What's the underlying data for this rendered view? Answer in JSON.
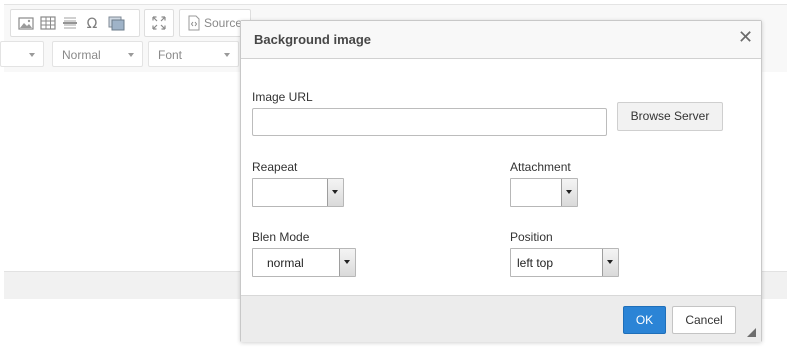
{
  "toolbar": {
    "source_label": "Source",
    "combos": [
      {
        "label": ""
      },
      {
        "label": "Normal"
      },
      {
        "label": "Font"
      }
    ]
  },
  "dialog": {
    "title": "Background image",
    "close_glyph": "✕",
    "image_url": {
      "label": "Image URL",
      "value": ""
    },
    "browse_label": "Browse Server",
    "repeat": {
      "label": "Reapeat",
      "value": ""
    },
    "attachment": {
      "label": "Attachment",
      "value": ""
    },
    "blend_mode": {
      "label": "Blen Mode",
      "value": "normal"
    },
    "position": {
      "label": "Position",
      "value": "left top"
    },
    "ok_label": "OK",
    "cancel_label": "Cancel"
  },
  "colors": {
    "ok_button": "#2b84d6",
    "footer": "#ececec",
    "title_bar": "#f8f8f8"
  }
}
